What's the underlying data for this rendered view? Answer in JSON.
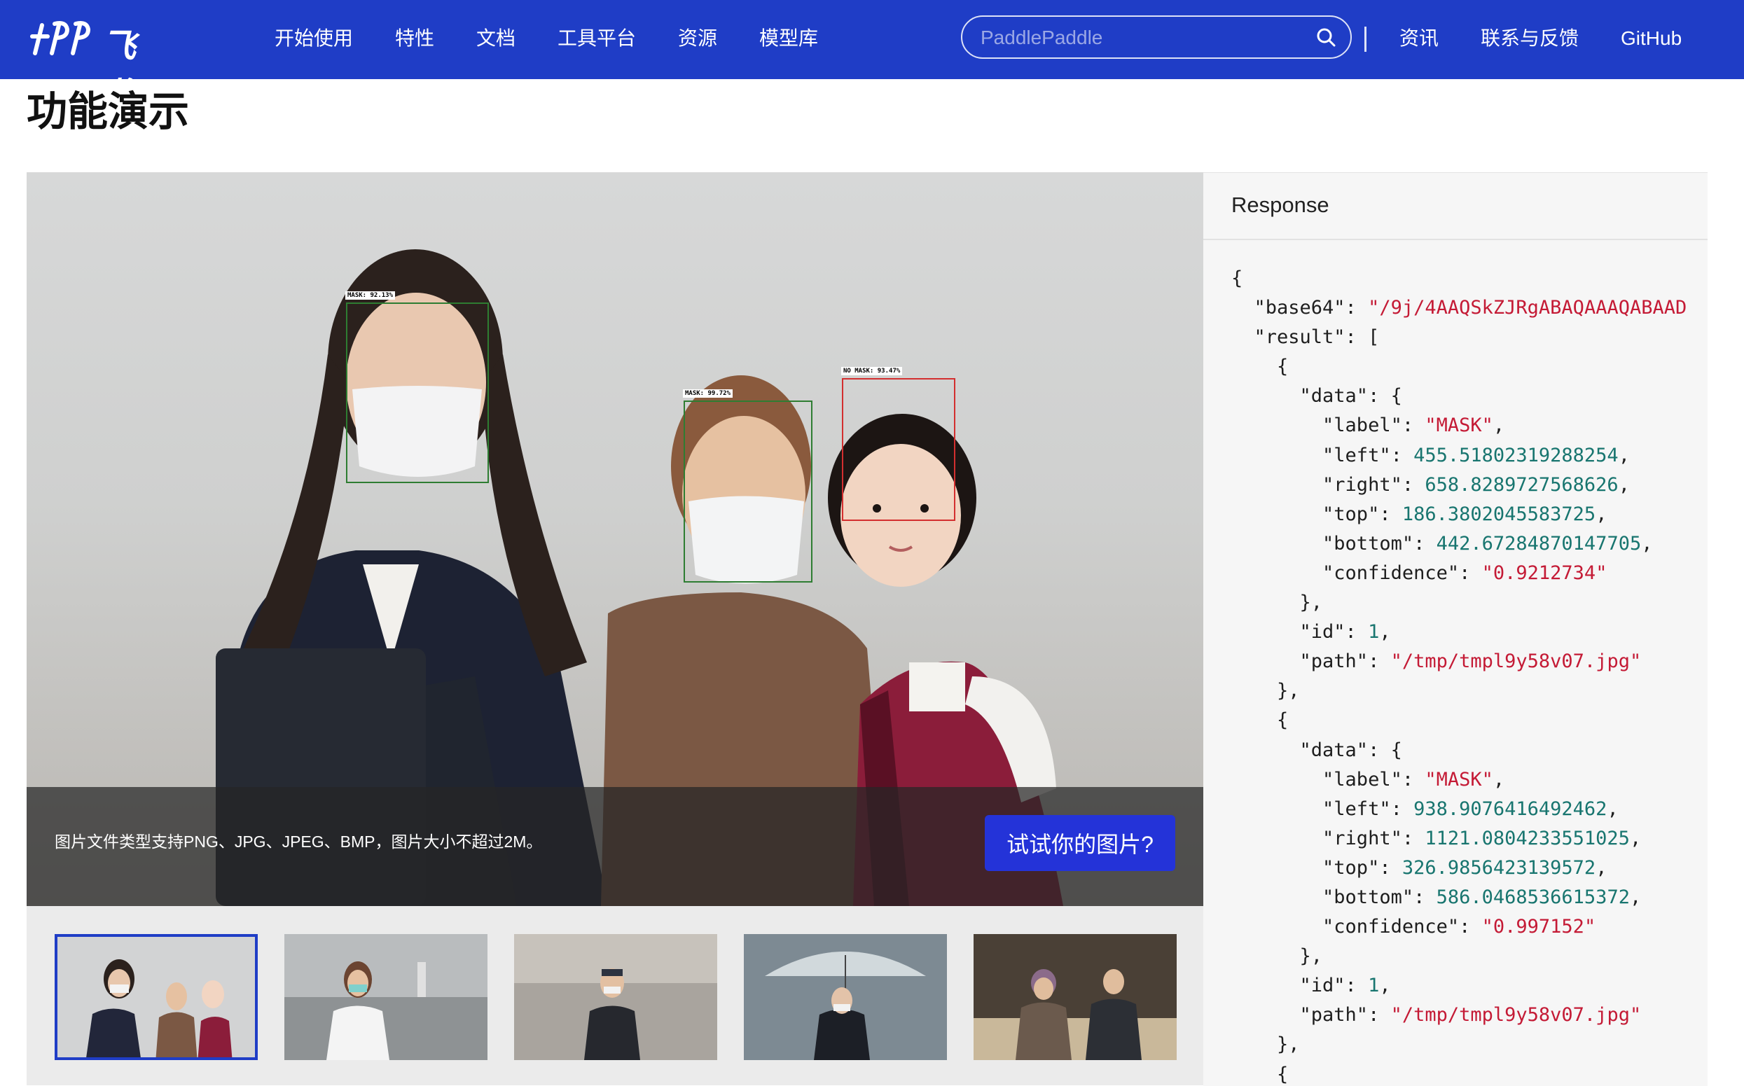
{
  "brand": {
    "logo_text": "飞桨"
  },
  "nav": {
    "items": [
      "开始使用",
      "特性",
      "文档",
      "工具平台",
      "资源",
      "模型库"
    ],
    "search_placeholder": "PaddlePaddle",
    "right_items": [
      "资讯",
      "联系与反馈",
      "GitHub"
    ]
  },
  "page": {
    "title": "功能演示"
  },
  "demo": {
    "hint": "图片文件类型支持PNG、JPG、JPEG、BMP，图片大小不超过2M。",
    "try_button": "试试你的图片?",
    "detections": [
      {
        "label": "MASK: 92.13%",
        "color": "#2e7d32"
      },
      {
        "label": "MASK: 99.72%",
        "color": "#2e7d32"
      },
      {
        "label": "NO MASK: 93.47%",
        "color": "#d32f2f"
      }
    ],
    "thumbnail_count": 5,
    "selected_thumbnail": 1
  },
  "response": {
    "title": "Response",
    "json": {
      "base64": "/9j/4AAQSkZJRgABAQAAAQABAAD",
      "results": [
        {
          "label": "MASK",
          "left": "455.51802319288254",
          "right": "658.8289727568626",
          "top": "186.3802045583725",
          "bottom": "442.67284870147705",
          "confidence": "0.9212734",
          "id": "1",
          "path": "/tmp/tmpl9y58v07.jpg"
        },
        {
          "label": "MASK",
          "left": "938.9076416492462",
          "right": "1121.0804233551025",
          "top": "326.9856423139572",
          "bottom": "586.0468536615372",
          "confidence": "0.997152",
          "id": "1",
          "path": "/tmp/tmpl9y58v07.jpg"
        }
      ]
    }
  },
  "colors": {
    "nav_bg": "#1f3dc6",
    "button_bg": "#2433d8",
    "string": "#c41a35",
    "number": "#18756f"
  }
}
